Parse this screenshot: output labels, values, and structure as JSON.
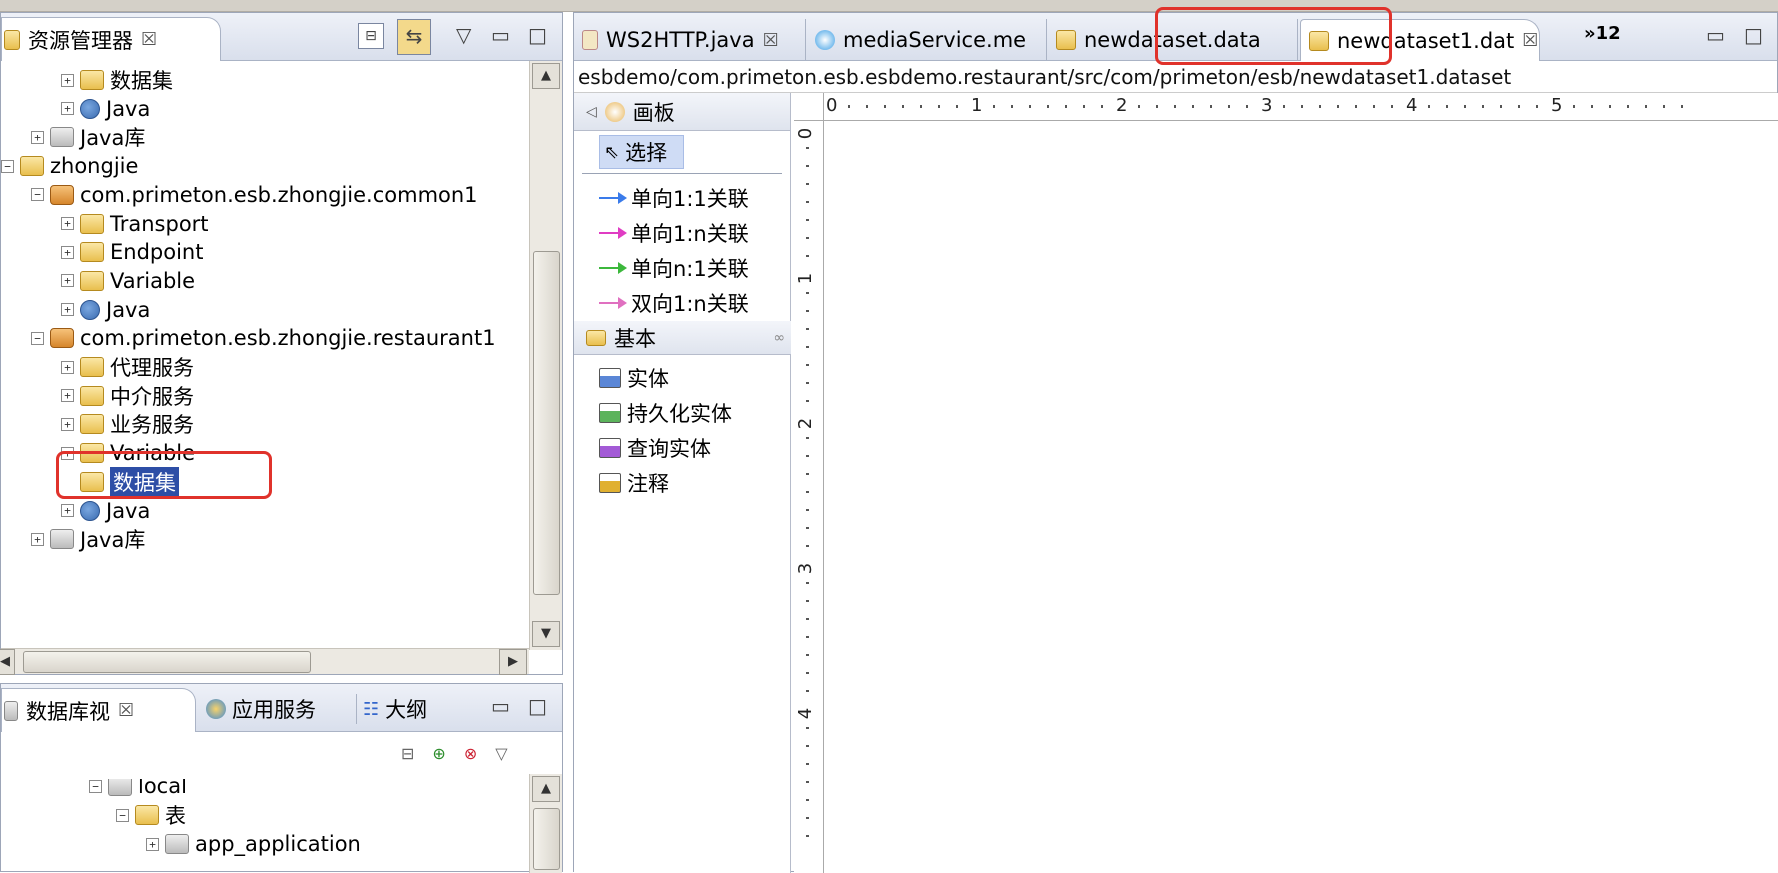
{
  "explorer": {
    "title": "资源管理器",
    "tree": [
      {
        "label": "数据集",
        "icon": "folder-icon"
      },
      {
        "label": "Java",
        "icon": "java-icon"
      },
      {
        "label": "Java库",
        "icon": "library-icon"
      },
      {
        "label": "zhongjie",
        "icon": "project-icon"
      },
      {
        "label": "com.primeton.esb.zhongjie.common1",
        "icon": "package-icon"
      },
      {
        "label": "Transport",
        "icon": "folder-icon"
      },
      {
        "label": "Endpoint",
        "icon": "folder-icon"
      },
      {
        "label": "Variable",
        "icon": "folder-icon"
      },
      {
        "label": "Java",
        "icon": "java-icon"
      },
      {
        "label": "com.primeton.esb.zhongjie.restaurant1",
        "icon": "package-icon"
      },
      {
        "label": "代理服务",
        "icon": "folder-icon"
      },
      {
        "label": "中介服务",
        "icon": "folder-icon"
      },
      {
        "label": "业务服务",
        "icon": "folder-icon"
      },
      {
        "label": "Variable",
        "icon": "folder-icon"
      },
      {
        "label": "数据集",
        "icon": "folder-icon"
      },
      {
        "label": "Java",
        "icon": "java-icon"
      },
      {
        "label": "Java库",
        "icon": "library-icon"
      }
    ]
  },
  "dbview": {
    "tabs": [
      "数据库视",
      "应用服务",
      "大纲"
    ],
    "tree": [
      {
        "label": "local",
        "icon": "database-icon"
      },
      {
        "label": "表",
        "icon": "folder-icon"
      },
      {
        "label": "app_application",
        "icon": "table-icon"
      }
    ]
  },
  "editor": {
    "tabs": [
      "WS2HTTP.java",
      "mediaService.me",
      "newdataset.data",
      "newdataset1.dat"
    ],
    "overflow": "»12",
    "path": "esbdemo/com.primeton.esb.esbdemo.restaurant/src/com/primeton/esb/newdataset1.dataset",
    "palette": {
      "title": "画板",
      "select": "选择",
      "links": [
        {
          "label": "单向1:1关联",
          "color": "#3a7bea"
        },
        {
          "label": "单向1:n关联",
          "color": "#e03cc3"
        },
        {
          "label": "单向n:1关联",
          "color": "#3cb83c"
        },
        {
          "label": "双向1:n关联",
          "color": "#e070c0"
        }
      ],
      "group": "基本",
      "items": [
        "实体",
        "持久化实体",
        "查询实体",
        "注释"
      ]
    },
    "ruler_h": [
      "0",
      "1",
      "2",
      "3",
      "4",
      "5"
    ],
    "ruler_v": [
      "0",
      "1",
      "2",
      "3",
      "4"
    ]
  }
}
